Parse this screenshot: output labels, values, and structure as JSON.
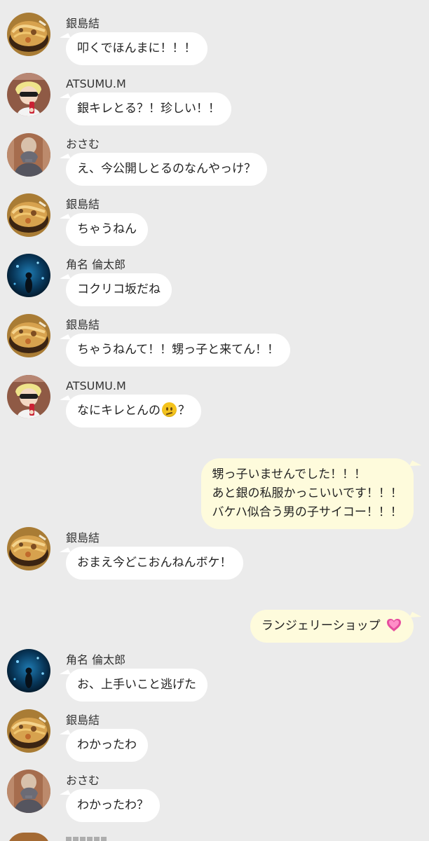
{
  "messages": [
    {
      "sender": "銀島結",
      "text": "叩くでほんまに！！！",
      "avatar": "ramen-avatar-icon"
    },
    {
      "sender": "ATSUMU.M",
      "text": "銀キレとる？！珍しい！！",
      "avatar": "blond-boy-avatar-icon"
    },
    {
      "sender": "おさむ",
      "text": "え、今公開しとるのなんやっけ？",
      "avatar": "hoodie-boy-avatar-icon"
    },
    {
      "sender": "銀島結",
      "text": "ちゃうねん",
      "avatar": "ramen-avatar-icon"
    },
    {
      "sender": "角名 倫太郎",
      "text": "コクリコ坂だね",
      "avatar": "aquarium-avatar-icon"
    },
    {
      "sender": "銀島結",
      "text": "ちゃうねんて！！甥っ子と来てん！！",
      "avatar": "ramen-avatar-icon"
    },
    {
      "sender": "ATSUMU.M",
      "text_before": "なにキレとんの",
      "emoji": "confused-face-icon",
      "text_after": "？",
      "avatar": "blond-boy-avatar-icon"
    },
    {
      "outgoing": true,
      "lines": [
        "甥っ子いませんでした！！！",
        "あと銀の私服かっこいいです！！！",
        "バケハ似合う男の子サイコー！！！"
      ]
    },
    {
      "sender": "銀島結",
      "text": "おまえ今どこおんねんボケ！",
      "avatar": "ramen-avatar-icon"
    },
    {
      "outgoing": true,
      "text": "ランジェリーショップ",
      "emoji": "pink-heart-icon"
    },
    {
      "sender": "角名 倫太郎",
      "text": "お、上手いこと逃げた",
      "avatar": "aquarium-avatar-icon"
    },
    {
      "sender": "銀島結",
      "text": "わかったわ",
      "avatar": "ramen-avatar-icon"
    },
    {
      "sender": "おさむ",
      "text": "わかったわ？",
      "avatar": "hoodie-boy-avatar-icon"
    }
  ],
  "colors": {
    "background": "#ebebeb",
    "incoming_bubble": "#ffffff",
    "outgoing_bubble": "#fefbdc",
    "text": "#222222"
  }
}
